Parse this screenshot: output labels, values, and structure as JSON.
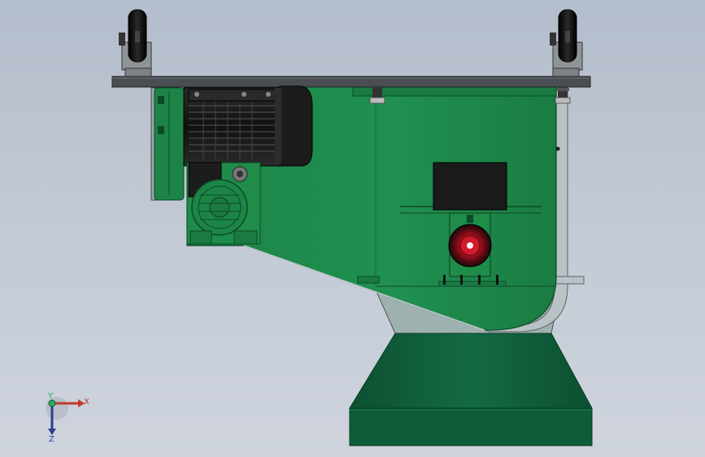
{
  "viewport": {
    "title": "",
    "background_top": "#b4bdcc",
    "background_bottom": "#cfd4dd"
  },
  "colors": {
    "body_green": "#1e8a4a",
    "body_green_dark": "#136634",
    "hopper_green": "#0f5c3a",
    "motor_black": "#1a1a1a",
    "frame_gray": "#4a4e52",
    "guard_gray": "#b9c2c4",
    "drum_red": "#c8102e"
  },
  "triad": {
    "x_label": "X",
    "y_label": "Y",
    "z_label": "Z",
    "x_color": "#c0392b",
    "y_color": "#27ae60",
    "z_color": "#2c3e91"
  },
  "components": [
    "caster-wheel-left",
    "caster-wheel-right",
    "top-mounting-plate",
    "drive-motor",
    "worm-gearbox",
    "v-belt-guard",
    "feeder-housing",
    "rotary-valve",
    "discharge-hopper"
  ]
}
